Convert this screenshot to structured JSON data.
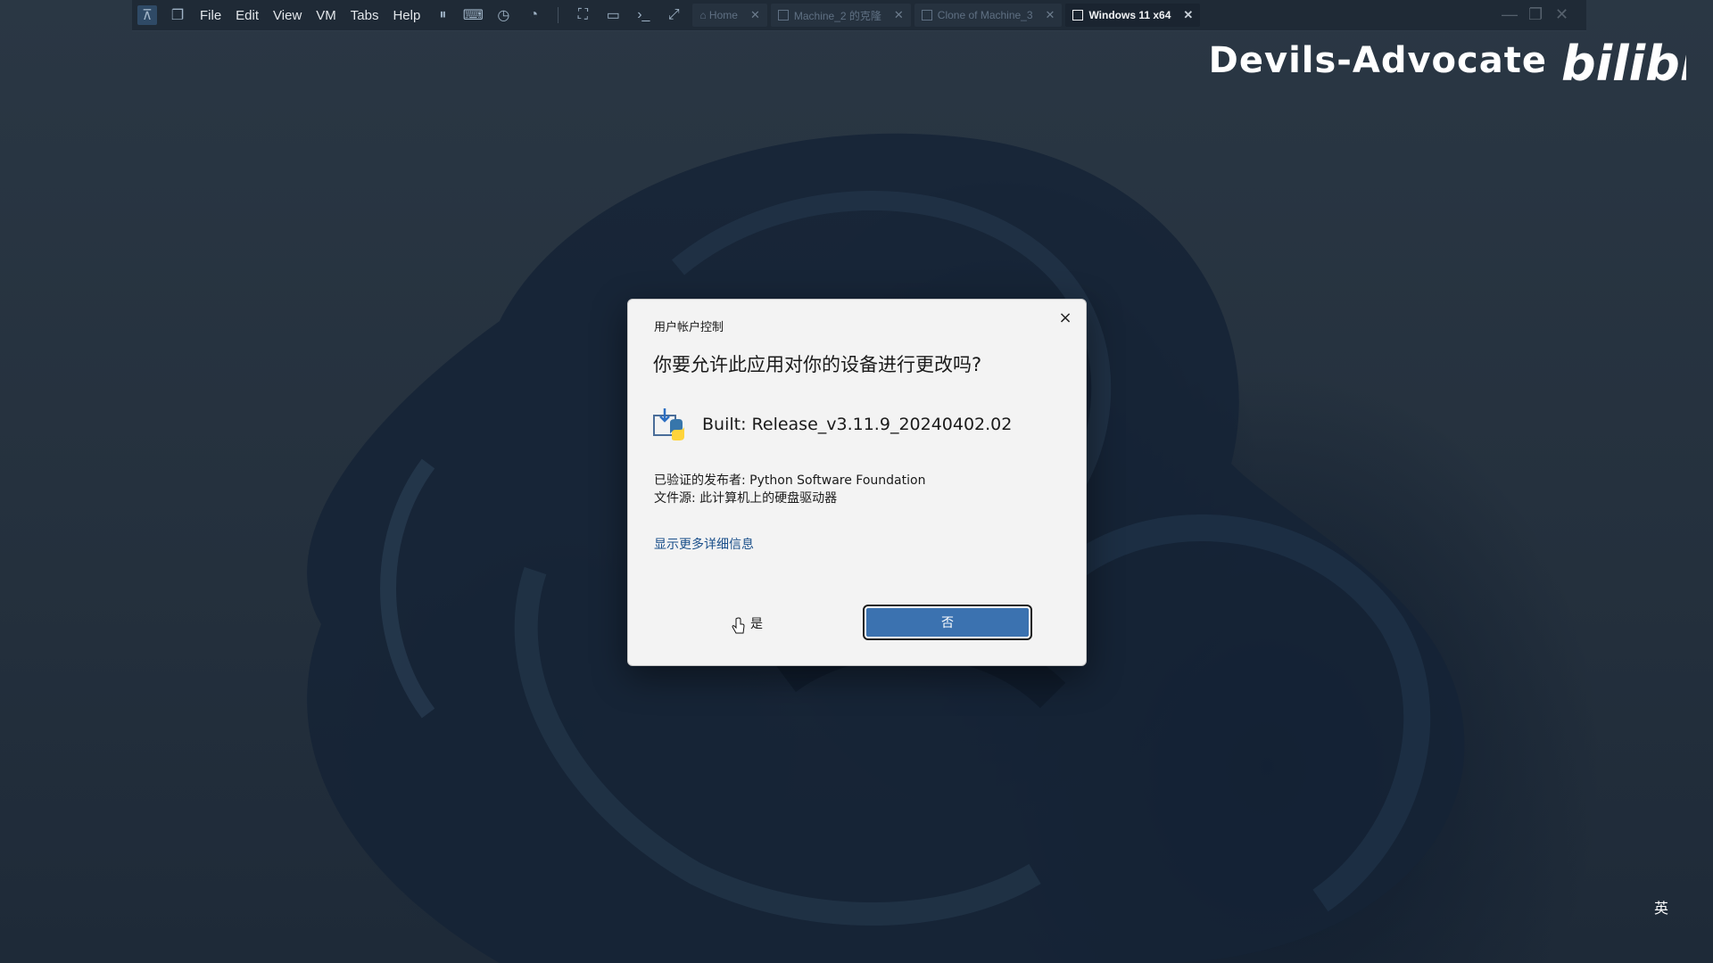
{
  "toolbar": {
    "menu": [
      "File",
      "Edit",
      "View",
      "VM",
      "Tabs",
      "Help"
    ],
    "tabs": [
      {
        "label": "Home",
        "active": false
      },
      {
        "label": "Machine_2 的克隆",
        "active": false
      },
      {
        "label": "Clone of Machine_3",
        "active": false
      },
      {
        "label": "Windows 11 x64",
        "active": true
      }
    ]
  },
  "watermark": {
    "text": "Devils-Advocate",
    "logo_text": "bilibili"
  },
  "uac": {
    "header": "用户帐户控制",
    "question": "你要允许此应用对你的设备进行更改吗?",
    "app_name": "Built: Release_v3.11.9_20240402.02",
    "publisher_line": "已验证的发布者: Python Software Foundation",
    "origin_line": "文件源: 此计算机上的硬盘驱动器",
    "details_link": "显示更多详细信息",
    "yes_label": "是",
    "no_label": "否",
    "close_symbol": "×"
  },
  "taskbar": {
    "ime": "英"
  },
  "colors": {
    "accent_button": "#3b72b0",
    "dialog_bg": "#f3f3f3",
    "desktop_bg": "#27333f"
  }
}
